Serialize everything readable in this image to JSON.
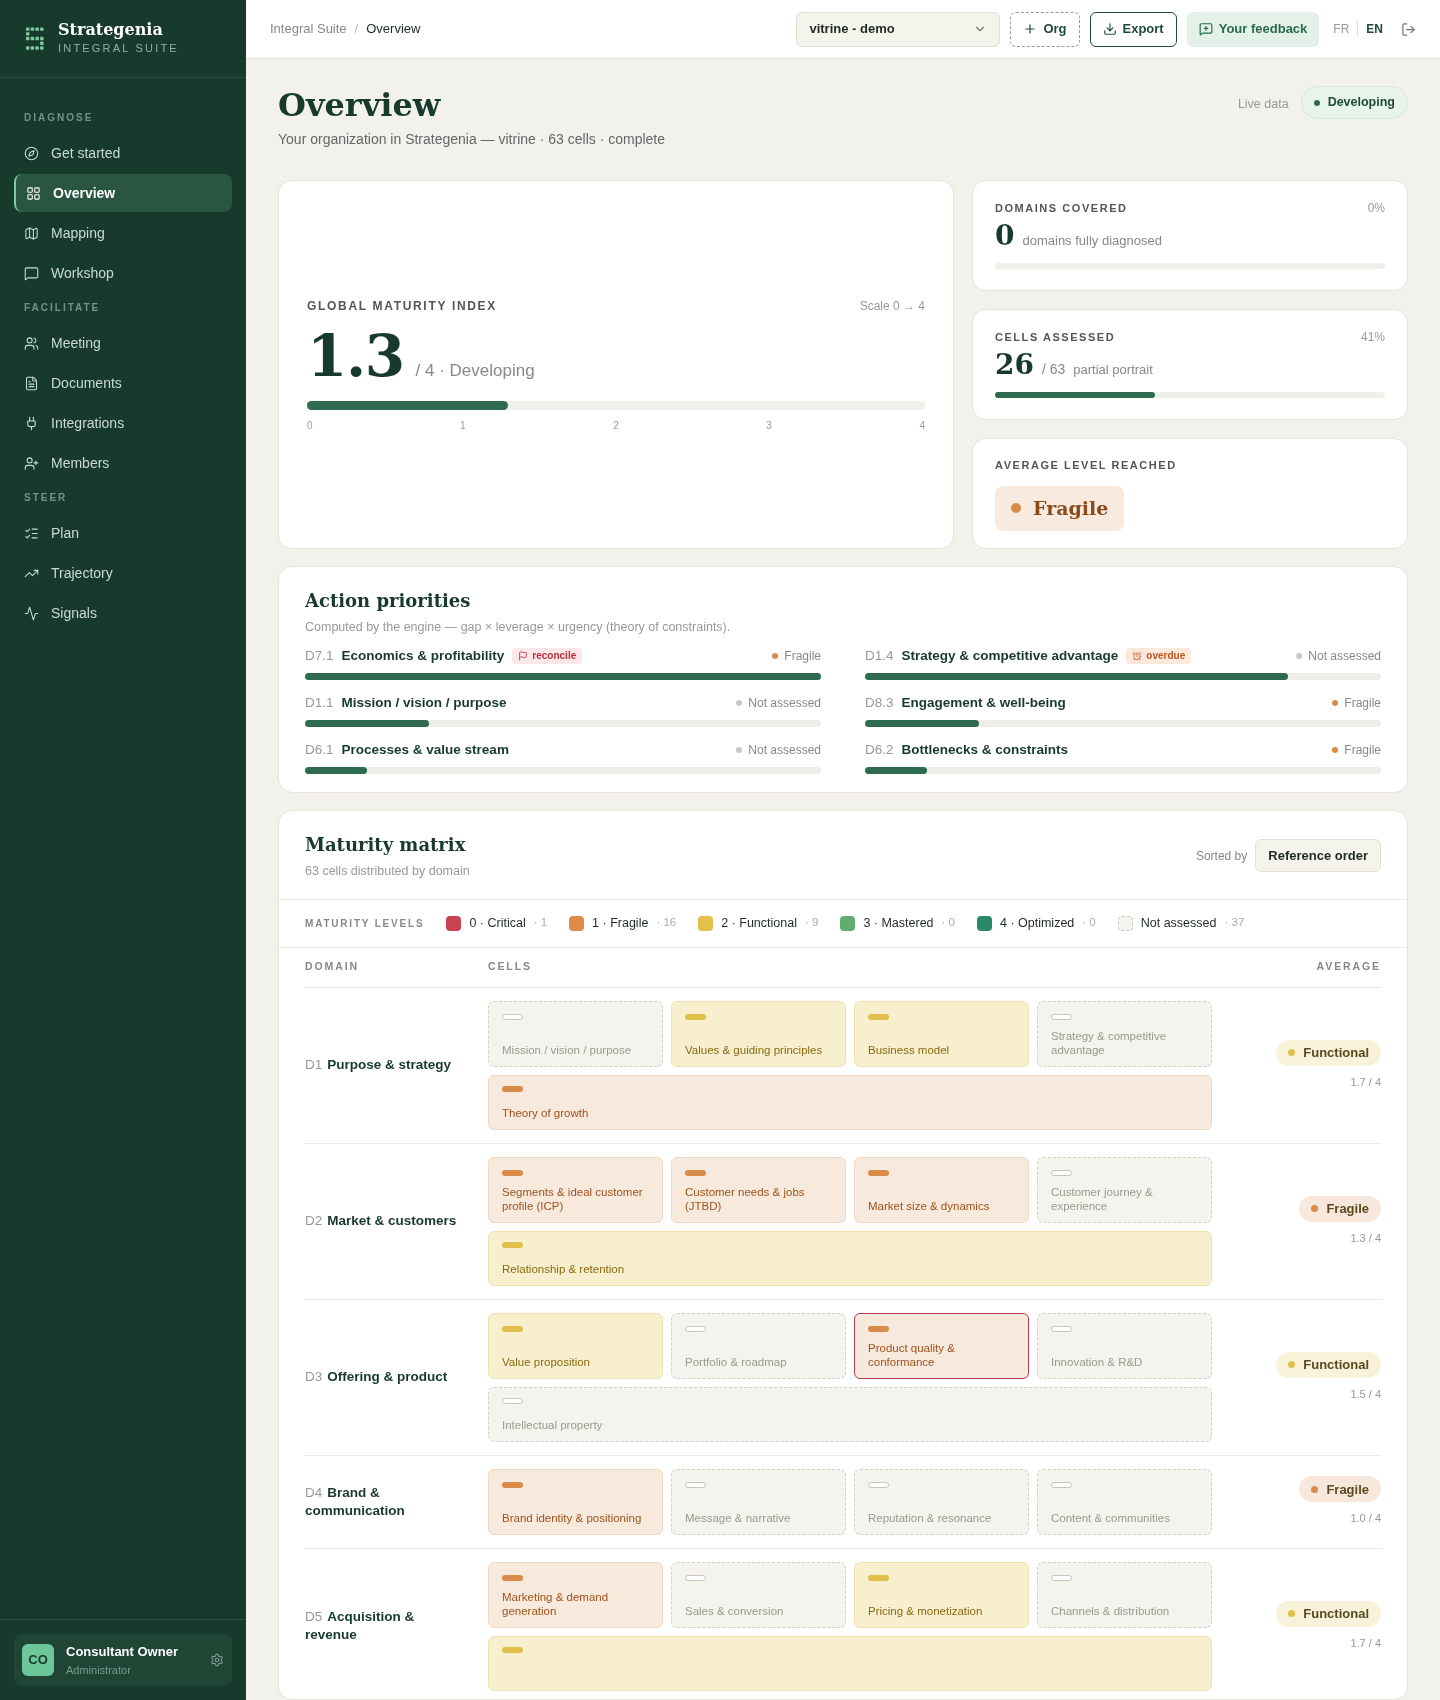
{
  "brand": {
    "name": "Strategenia",
    "subtitle": "INTEGRAL SUITE"
  },
  "sidebar": {
    "groups": [
      {
        "label": "DIAGNOSE",
        "items": [
          {
            "label": "Get started",
            "selected": false
          },
          {
            "label": "Overview",
            "selected": true
          },
          {
            "label": "Mapping",
            "selected": false
          },
          {
            "label": "Workshop",
            "selected": false
          }
        ]
      },
      {
        "label": "FACILITATE",
        "items": [
          {
            "label": "Meeting",
            "selected": false
          },
          {
            "label": "Documents",
            "selected": false
          },
          {
            "label": "Integrations",
            "selected": false
          },
          {
            "label": "Members",
            "selected": false
          }
        ]
      },
      {
        "label": "STEER",
        "items": [
          {
            "label": "Plan",
            "selected": false
          },
          {
            "label": "Trajectory",
            "selected": false
          },
          {
            "label": "Signals",
            "selected": false
          }
        ]
      }
    ],
    "user": {
      "initials": "CO",
      "name": "Consultant Owner",
      "role": "Administrator"
    }
  },
  "topbar": {
    "breadcrumb": [
      "Integral Suite",
      "Overview"
    ],
    "separator": "/",
    "org_select": "vitrine - demo",
    "buttons": [
      {
        "label": "Org",
        "kind": "add"
      },
      {
        "label": "Export",
        "kind": "export"
      },
      {
        "label": "Your feedback",
        "kind": "feedback"
      }
    ],
    "languages": [
      {
        "label": "FR",
        "selected": false
      },
      {
        "label": "EN",
        "selected": true
      }
    ]
  },
  "page": {
    "title": "Overview",
    "subtitle": "Your organization in Strategenia — vitrine · 63 cells · complete",
    "live_label": "Live data",
    "status": "Developing"
  },
  "global_index": {
    "title": "GLOBAL MATURITY INDEX",
    "scale": "Scale 0 → 4",
    "value": "1.3",
    "suffix": "/ 4 · Developing",
    "level": 0.325,
    "ticks": [
      "0",
      "1",
      "2",
      "3",
      "4"
    ]
  },
  "stats": [
    {
      "kind": "count",
      "title": "DOMAINS COVERED",
      "percent": "0%",
      "value": "0",
      "caption": "domains fully diagnosed"
    },
    {
      "kind": "count",
      "title": "CELLS ASSESSED",
      "percent": "41%",
      "value": "26",
      "of": "/ 63",
      "caption": "partial portrait",
      "level": 0.41
    },
    {
      "kind": "badge",
      "title": "AVERAGE LEVEL REACHED",
      "badge": {
        "label": "Fragile",
        "color": "#d98b4a"
      }
    }
  ],
  "priorities": {
    "title": "Action priorities",
    "subtitle": "Computed by the engine — gap × leverage × urgency (theory of constraints).",
    "items": [
      {
        "code": "D7.1",
        "title": "Economics & profitability",
        "tag": {
          "label": "reconcile",
          "kind": "reconcile"
        },
        "status": {
          "label": "Fragile",
          "color": "#d98b4a"
        },
        "level": 1.0
      },
      {
        "code": "D1.4",
        "title": "Strategy & competitive advantage",
        "tag": {
          "label": "overdue",
          "kind": "overdue"
        },
        "status": {
          "label": "Not assessed",
          "color": "#c9c9c0"
        },
        "level": 0.82
      },
      {
        "code": "D1.1",
        "title": "Mission / vision / purpose",
        "status": {
          "label": "Not assessed",
          "color": "#c9c9c0"
        },
        "level": 0.24
      },
      {
        "code": "D8.3",
        "title": "Engagement & well-being",
        "status": {
          "label": "Fragile",
          "color": "#d98b4a"
        },
        "level": 0.22
      },
      {
        "code": "D6.1",
        "title": "Processes & value stream",
        "status": {
          "label": "Not assessed",
          "color": "#c9c9c0"
        },
        "level": 0.12
      },
      {
        "code": "D6.2",
        "title": "Bottlenecks & constraints",
        "status": {
          "label": "Fragile",
          "color": "#d98b4a"
        },
        "level": 0.12
      }
    ]
  },
  "matrix": {
    "title": "Maturity matrix",
    "subtitle": "63 cells distributed by domain",
    "sort_label": "Sorted by",
    "sort_value": "Reference order",
    "legend_title": "MATURITY LEVELS",
    "legend": [
      {
        "label": "0 · Critical",
        "count": "· 1",
        "color": "#c8434f",
        "kind": "solid"
      },
      {
        "label": "1 · Fragile",
        "count": "· 16",
        "color": "#df8c48",
        "kind": "solid"
      },
      {
        "label": "2 · Functional",
        "count": "· 9",
        "color": "#e3c04a",
        "kind": "solid"
      },
      {
        "label": "3 · Mastered",
        "count": "· 0",
        "color": "#5fae6e",
        "kind": "solid"
      },
      {
        "label": "4 · Optimized",
        "count": "· 0",
        "color": "#2a8a68",
        "kind": "solid"
      },
      {
        "label": "Not assessed",
        "count": "· 37",
        "color": "#f4f3ee",
        "kind": "dashed"
      }
    ],
    "columns": [
      "DOMAIN",
      "CELLS",
      "AVERAGE"
    ],
    "domains": [
      {
        "code": "D1",
        "name": "Purpose & strategy",
        "average": {
          "label": "Functional",
          "color": "#e0c04a"
        },
        "score": "1.7 / 4",
        "cells": [
          {
            "name": "Mission / vision / purpose",
            "kind": "unassessed",
            "flagged": false
          },
          {
            "name": "Values & guiding principles",
            "kind": "functional",
            "flagged": false
          },
          {
            "name": "Business model",
            "kind": "functional",
            "flagged": false
          },
          {
            "name": "Strategy & competitive advantage",
            "kind": "unassessed",
            "flagged": false
          },
          {
            "name": "Theory of growth",
            "kind": "fragile",
            "flagged": false
          }
        ]
      },
      {
        "code": "D2",
        "name": "Market & customers",
        "average": {
          "label": "Fragile",
          "color": "#d98b4a"
        },
        "score": "1.3 / 4",
        "cells": [
          {
            "name": "Segments & ideal customer profile (ICP)",
            "kind": "fragile",
            "flagged": false
          },
          {
            "name": "Customer needs & jobs (JTBD)",
            "kind": "fragile",
            "flagged": false
          },
          {
            "name": "Market size & dynamics",
            "kind": "fragile",
            "flagged": false
          },
          {
            "name": "Customer journey & experience",
            "kind": "unassessed",
            "flagged": false
          },
          {
            "name": "Relationship & retention",
            "kind": "functional",
            "flagged": false
          }
        ]
      },
      {
        "code": "D3",
        "name": "Offering & product",
        "average": {
          "label": "Functional",
          "color": "#e0c04a"
        },
        "score": "1.5 / 4",
        "cells": [
          {
            "name": "Value proposition",
            "kind": "functional",
            "flagged": false
          },
          {
            "name": "Portfolio & roadmap",
            "kind": "unassessed",
            "flagged": false
          },
          {
            "name": "Product quality & conformance",
            "kind": "fragile",
            "flagged": true
          },
          {
            "name": "Innovation & R&D",
            "kind": "unassessed",
            "flagged": false
          },
          {
            "name": "Intellectual property",
            "kind": "unassessed",
            "flagged": false
          }
        ]
      },
      {
        "code": "D4",
        "name": "Brand & communication",
        "average": {
          "label": "Fragile",
          "color": "#d98b4a"
        },
        "score": "1.0 / 4",
        "cells": [
          {
            "name": "Brand identity & positioning",
            "kind": "fragile",
            "flagged": false
          },
          {
            "name": "Message & narrative",
            "kind": "unassessed",
            "flagged": false
          },
          {
            "name": "Reputation & resonance",
            "kind": "unassessed",
            "flagged": false
          },
          {
            "name": "Content & communities",
            "kind": "unassessed",
            "flagged": false
          }
        ]
      },
      {
        "code": "D5",
        "name": "Acquisition & revenue",
        "average": {
          "label": "Functional",
          "color": "#e0c04a"
        },
        "score": "1.7 / 4",
        "cells": [
          {
            "name": "Marketing & demand generation",
            "kind": "fragile",
            "flagged": false
          },
          {
            "name": "Sales & conversion",
            "kind": "unassessed",
            "flagged": false
          },
          {
            "name": "Pricing & monetization",
            "kind": "functional",
            "flagged": false
          },
          {
            "name": "Channels & distribution",
            "kind": "unassessed",
            "flagged": false
          },
          {
            "kind": "functional",
            "flagged": false
          }
        ]
      }
    ]
  }
}
